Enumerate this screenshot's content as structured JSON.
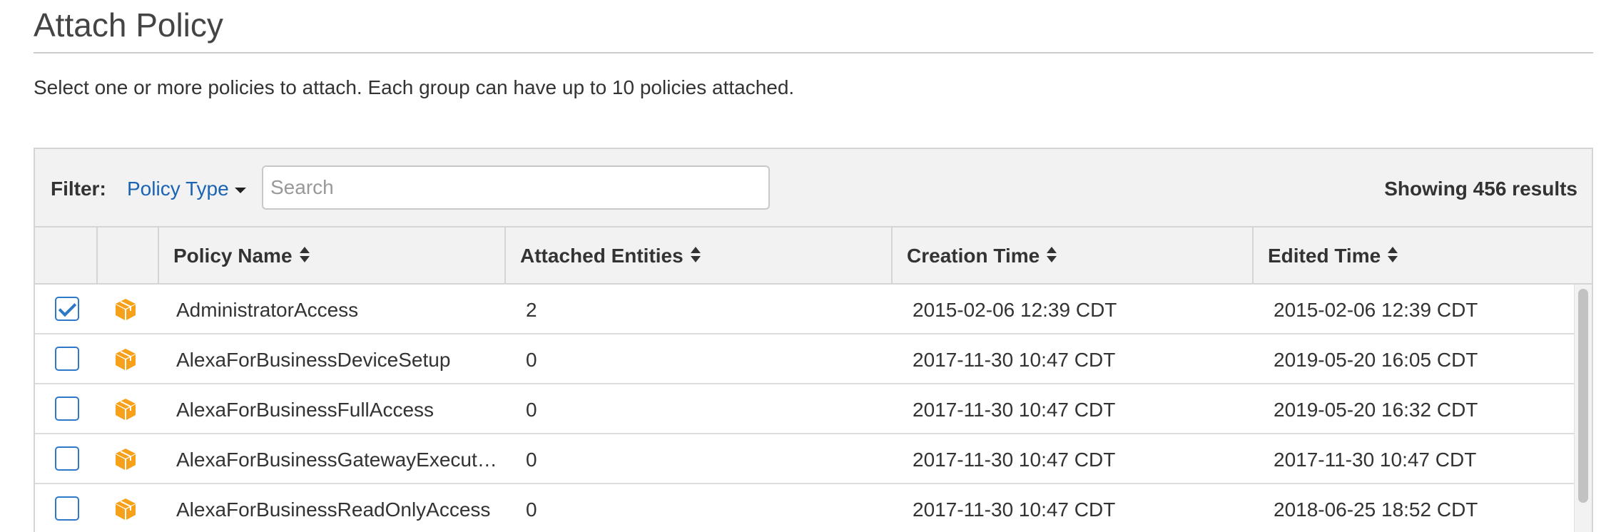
{
  "page": {
    "title": "Attach Policy",
    "description": "Select one or more policies to attach. Each group can have up to 10 policies attached."
  },
  "filter": {
    "label": "Filter:",
    "policy_type": "Policy Type",
    "search_placeholder": "Search",
    "results": "Showing 456 results"
  },
  "table": {
    "columns": [
      "Policy Name",
      "Attached Entities",
      "Creation Time",
      "Edited Time"
    ],
    "rows": [
      {
        "checked": true,
        "icon": "policy-cube-icon",
        "name": "AdministratorAccess",
        "attached": "2",
        "created": "2015-02-06 12:39 CDT",
        "edited": "2015-02-06 12:39 CDT"
      },
      {
        "checked": false,
        "icon": "policy-cube-icon",
        "name": "AlexaForBusinessDeviceSetup",
        "attached": "0",
        "created": "2017-11-30 10:47 CDT",
        "edited": "2019-05-20 16:05 CDT"
      },
      {
        "checked": false,
        "icon": "policy-cube-icon",
        "name": "AlexaForBusinessFullAccess",
        "attached": "0",
        "created": "2017-11-30 10:47 CDT",
        "edited": "2019-05-20 16:32 CDT"
      },
      {
        "checked": false,
        "icon": "policy-cube-icon",
        "name": "AlexaForBusinessGatewayExecut…",
        "attached": "0",
        "created": "2017-11-30 10:47 CDT",
        "edited": "2017-11-30 10:47 CDT"
      },
      {
        "checked": false,
        "icon": "policy-cube-icon",
        "name": "AlexaForBusinessReadOnlyAccess",
        "attached": "0",
        "created": "2017-11-30 10:47 CDT",
        "edited": "2018-06-25 18:52 CDT"
      }
    ]
  },
  "colors": {
    "accent": "#2d78c7",
    "link": "#1a64b3",
    "icon_orange": "#f7a11a",
    "header_bg": "#f2f2f2",
    "border": "#d5d5d5"
  }
}
